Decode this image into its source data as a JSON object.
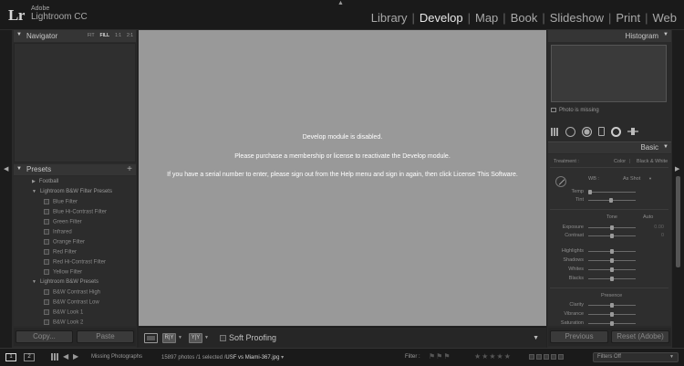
{
  "app": {
    "brand_top": "Adobe",
    "brand_name": "Lightroom CC",
    "logo": "Lr"
  },
  "modules": [
    {
      "label": "Library",
      "active": false
    },
    {
      "label": "Develop",
      "active": true
    },
    {
      "label": "Map",
      "active": false
    },
    {
      "label": "Book",
      "active": false
    },
    {
      "label": "Slideshow",
      "active": false
    },
    {
      "label": "Print",
      "active": false
    },
    {
      "label": "Web",
      "active": false
    }
  ],
  "module_separator": "|",
  "navigator": {
    "title": "Navigator",
    "zoom": [
      "FIT",
      "FILL",
      "1:1",
      "2:1"
    ],
    "zoom_selected": "FILL"
  },
  "presets": {
    "title": "Presets",
    "add_icon": "+",
    "items": [
      {
        "label": "Football",
        "type": "folder"
      },
      {
        "label": "Lightroom B&W Filter Presets",
        "type": "folder-open"
      },
      {
        "label": "Blue Filter",
        "type": "preset"
      },
      {
        "label": "Blue Hi-Contrast Filter",
        "type": "preset"
      },
      {
        "label": "Green Filter",
        "type": "preset"
      },
      {
        "label": "Infrared",
        "type": "preset"
      },
      {
        "label": "Orange Filter",
        "type": "preset"
      },
      {
        "label": "Red Filter",
        "type": "preset"
      },
      {
        "label": "Red Hi-Contrast Filter",
        "type": "preset"
      },
      {
        "label": "Yellow Filter",
        "type": "preset"
      },
      {
        "label": "Lightroom B&W Presets",
        "type": "folder-open"
      },
      {
        "label": "B&W Contrast High",
        "type": "preset"
      },
      {
        "label": "B&W Contrast Low",
        "type": "preset"
      },
      {
        "label": "B&W Look 1",
        "type": "preset"
      },
      {
        "label": "B&W Look 2",
        "type": "preset"
      }
    ]
  },
  "left_buttons": {
    "copy": "Copy...",
    "paste": "Paste"
  },
  "center": {
    "message_line1": "Develop module is disabled.",
    "message_line2": "Please purchase a membership or license to reactivate the Develop module.",
    "message_line3": "If you have a serial number to enter, please sign out from the Help menu and sign in again, then click License This Software."
  },
  "toolbar": {
    "ry_label": "R|Y",
    "yy_label": "Y|Y",
    "soft_proofing": "Soft Proofing",
    "soft_proofing_checked": false
  },
  "histogram": {
    "title": "Histogram",
    "photo_missing": "Photo is missing"
  },
  "basic": {
    "title": "Basic",
    "treatment_label": "Treatment :",
    "treatment_color": "Color",
    "treatment_bw": "Black & White",
    "wb_label": "WB :",
    "wb_value": "As Shot",
    "temp": "Temp",
    "tint": "Tint",
    "tone_label": "Tone",
    "auto_label": "Auto",
    "exposure": "Exposure",
    "exposure_value": "0.00",
    "contrast": "Contrast",
    "contrast_value": "0",
    "highlights": "Highlights",
    "shadows": "Shadows",
    "whites": "Whites",
    "blacks": "Blacks",
    "presence_label": "Presence",
    "clarity": "Clarity",
    "vibrance": "Vibrance",
    "saturation": "Saturation"
  },
  "right_buttons": {
    "previous": "Previous",
    "reset": "Reset (Adobe)"
  },
  "filmstrip": {
    "screen1": "1",
    "screen2": "2",
    "source": "Missing Photographs",
    "count": "15897 photos /1 selected /",
    "filename": "USF vs Miami-367.jpg",
    "filter_label": "Filter :",
    "filters_off": "Filters Off"
  }
}
